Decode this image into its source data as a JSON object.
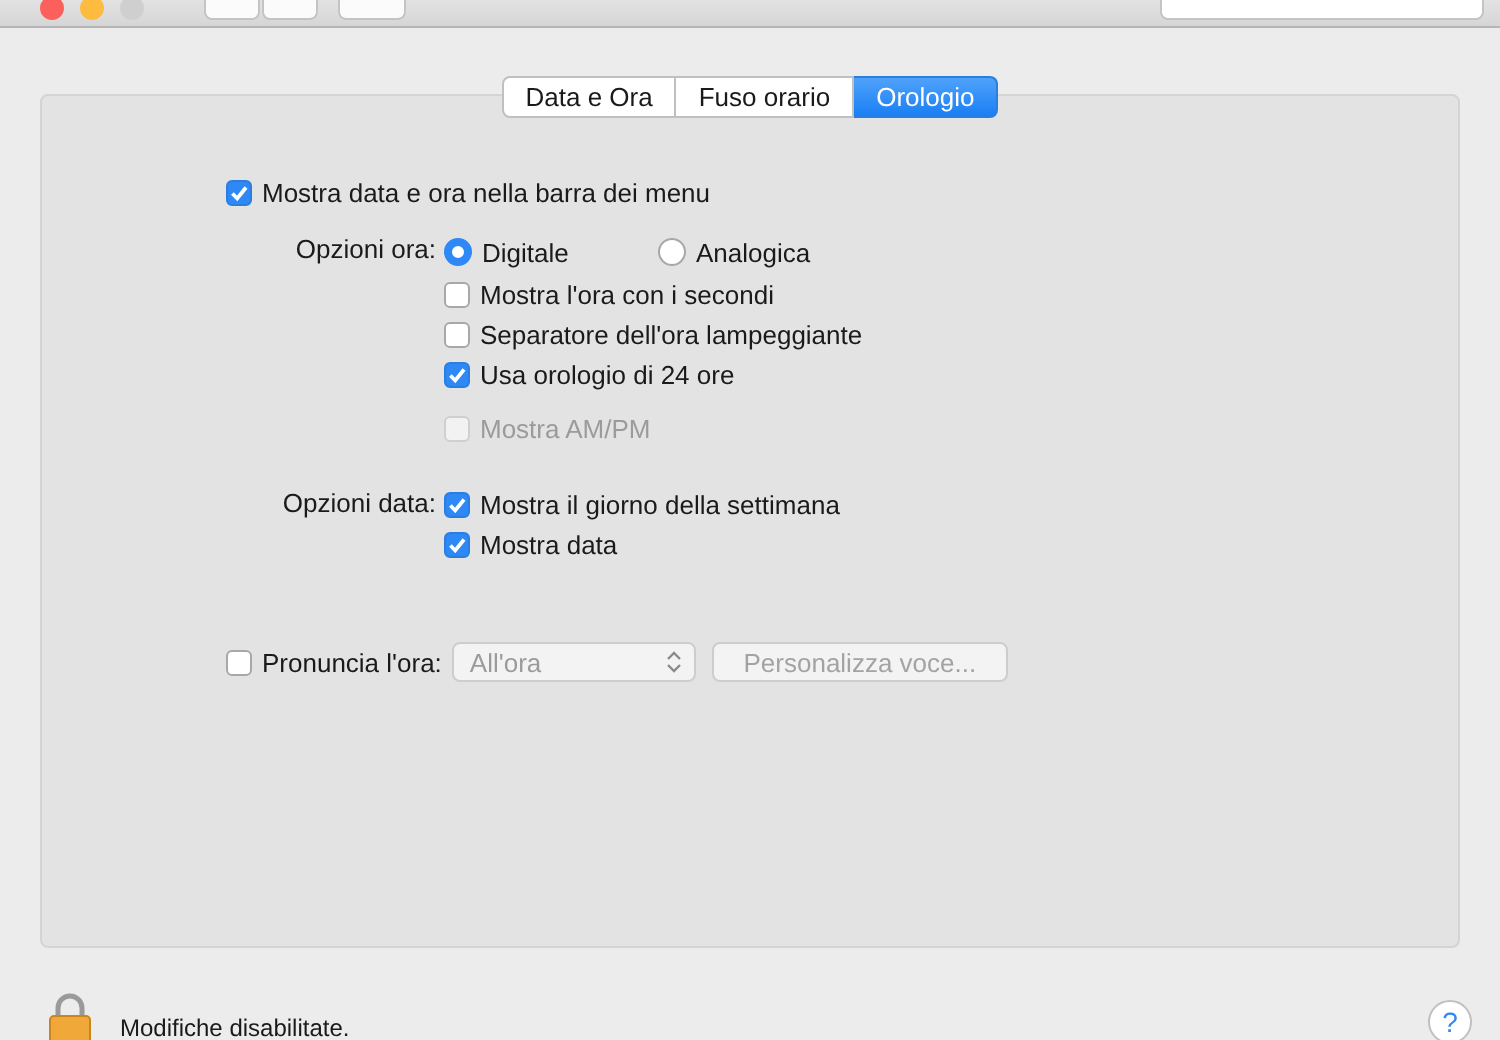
{
  "tabs": [
    {
      "label": "Data e Ora",
      "selected": false
    },
    {
      "label": "Fuso orario",
      "selected": false
    },
    {
      "label": "Orologio",
      "selected": true
    }
  ],
  "show_in_menubar": {
    "label": "Mostra data e ora nella barra dei menu",
    "checked": true
  },
  "time_options": {
    "label": "Opzioni ora:",
    "formats": [
      {
        "label": "Digitale",
        "selected": true
      },
      {
        "label": "Analogica",
        "selected": false
      }
    ],
    "checkboxes": [
      {
        "label": "Mostra l'ora con i secondi",
        "checked": false,
        "disabled": false
      },
      {
        "label": "Separatore dell'ora lampeggiante",
        "checked": false,
        "disabled": false
      },
      {
        "label": "Usa orologio di 24 ore",
        "checked": true,
        "disabled": false
      }
    ],
    "am_pm": {
      "label": "Mostra AM/PM",
      "checked": false,
      "disabled": true
    }
  },
  "date_options": {
    "label": "Opzioni data:",
    "checkboxes": [
      {
        "label": "Mostra il giorno della settimana",
        "checked": true,
        "disabled": false
      },
      {
        "label": "Mostra data",
        "checked": true,
        "disabled": false
      }
    ]
  },
  "speak": {
    "label": "Pronuncia l'ora:",
    "checked": false,
    "interval": {
      "value": "All'ora",
      "disabled": true
    },
    "customize_button": {
      "label": "Personalizza voce...",
      "disabled": true
    }
  },
  "footer": {
    "lock_text": "Modifiche disabilitate.",
    "help": "?"
  }
}
